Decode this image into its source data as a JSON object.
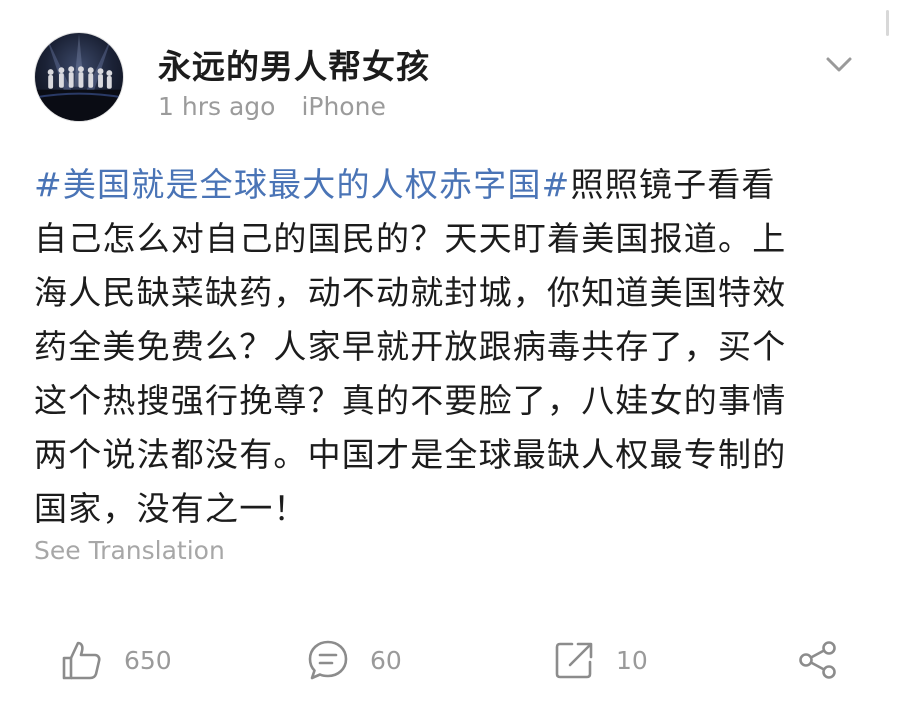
{
  "post": {
    "author": "永远的男人帮女孩",
    "time": "1 hrs ago",
    "device": "iPhone",
    "hashtag": "#美国就是全球最大的人权赤字国#",
    "body": "照照镜子看看\n自己怎么对自己的国民的？天天盯着美国报道。上\n海人民缺菜缺药，动不动就封城，你知道美国特效\n药全美免费么？人家早就开放跟病毒共存了，买个\n这个热搜强行挽尊？真的不要脸了，八娃女的事情\n两个说法都没有。中国才是全球最缺人权最专制的\n国家，没有之一！",
    "translate_label": "See Translation"
  },
  "actions": {
    "likes": "650",
    "comments": "60",
    "reposts": "10"
  },
  "icons": {
    "like": "thumbs-up-icon",
    "comment": "comment-icon",
    "repost": "repost-icon",
    "share": "share-icon",
    "menu": "chevron-down-icon"
  },
  "colors": {
    "hashtag": "#4a74b6",
    "meta": "#9b9b9b",
    "icon": "#8c8c8c"
  }
}
